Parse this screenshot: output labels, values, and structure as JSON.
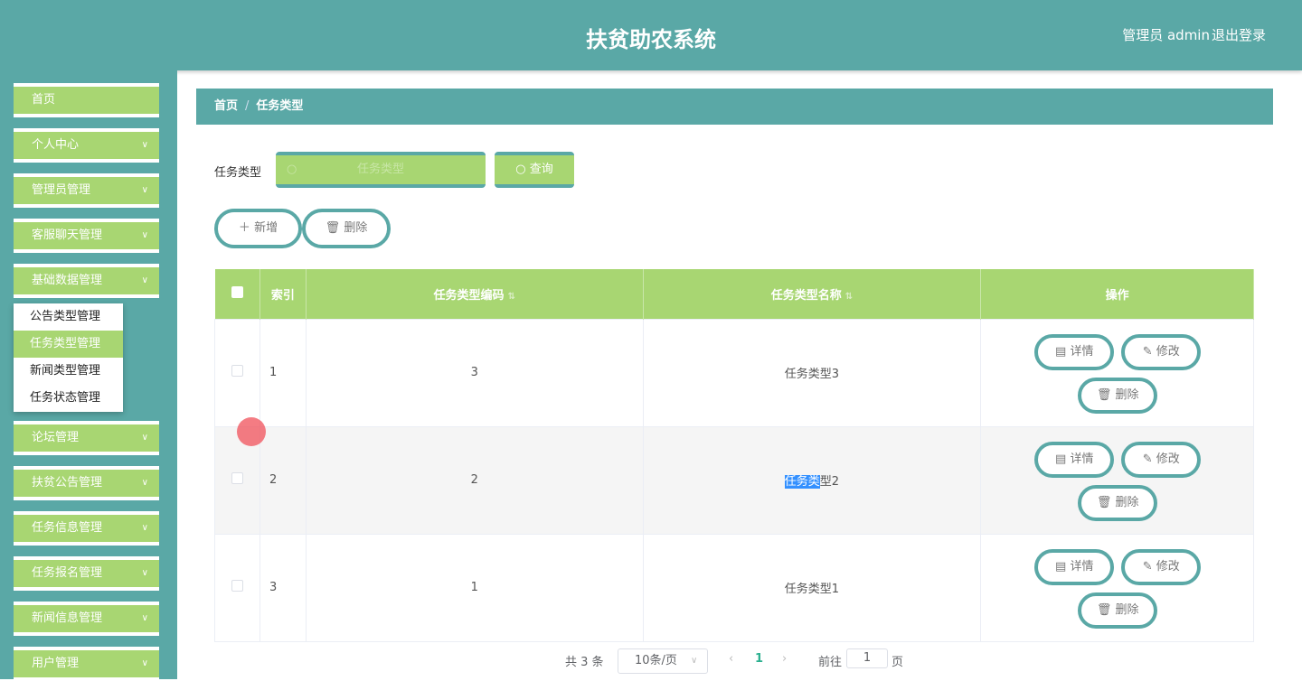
{
  "header": {
    "title": "扶贫助农系统",
    "user": "管理员 admin",
    "logout": "退出登录"
  },
  "sidebar": {
    "items": [
      {
        "label": "首页",
        "chevron": false
      },
      {
        "label": "个人中心",
        "chevron": true
      },
      {
        "label": "管理员管理",
        "chevron": true
      },
      {
        "label": "客服聊天管理",
        "chevron": true
      },
      {
        "label": "基础数据管理",
        "chevron": true
      },
      {
        "label": "论坛管理",
        "chevron": true
      },
      {
        "label": "扶贫公告管理",
        "chevron": true
      },
      {
        "label": "任务信息管理",
        "chevron": true
      },
      {
        "label": "任务报名管理",
        "chevron": true
      },
      {
        "label": "新闻信息管理",
        "chevron": true
      },
      {
        "label": "用户管理",
        "chevron": true
      }
    ],
    "submenu": [
      "公告类型管理",
      "任务类型管理",
      "新闻类型管理",
      "任务状态管理"
    ]
  },
  "breadcrumb": {
    "home": "首页",
    "sep": "/",
    "current": "任务类型"
  },
  "filter": {
    "label": "任务类型",
    "placeholder": "任务类型",
    "search": "查询"
  },
  "actions": {
    "add": "新增",
    "delete": "删除"
  },
  "table": {
    "headers": [
      "索引",
      "任务类型编码",
      "任务类型名称",
      "操作"
    ],
    "rows": [
      {
        "index": "1",
        "code": "3",
        "name": "任务类型3"
      },
      {
        "index": "2",
        "code": "2",
        "name_sel": "任务类",
        "name_rest": "型2"
      },
      {
        "index": "3",
        "code": "1",
        "name": "任务类型1"
      }
    ],
    "ops": {
      "detail": "详情",
      "edit": "修改",
      "delete": "删除"
    }
  },
  "pagination": {
    "total": "共 3 条",
    "size": "10条/页",
    "current": "1",
    "goto": "前往",
    "page_input": "1",
    "page_suffix": "页"
  }
}
